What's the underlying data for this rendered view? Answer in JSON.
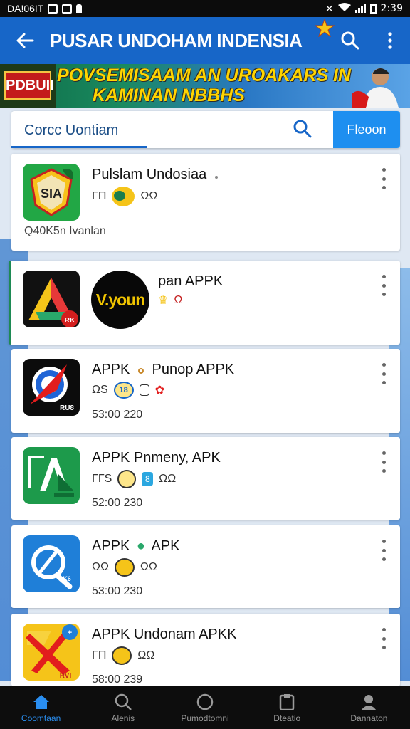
{
  "status_bar": {
    "left_text": "DA!06IT",
    "time": "2:39"
  },
  "app_bar": {
    "title": "PUSAR UNDOHAM INDENSIA",
    "back_icon": "back-arrow-icon",
    "search_icon": "search-icon",
    "menu_icon": "more-vertical-icon"
  },
  "banner": {
    "logo_text": "PDBUII",
    "line1": "POVSEMISAAM AN UROAKARS IN",
    "line2": "KAMINAN NBBHS"
  },
  "search": {
    "query": "Corcc Uontiam",
    "action_label": "Fleoon"
  },
  "apps": [
    {
      "name": "Pulslam Undosiaa",
      "extra": "",
      "date": "",
      "meta": "Q40K5n Ivanlan",
      "icon_text": "SIA"
    },
    {
      "name": "pan APPK",
      "extra": "",
      "date": "",
      "meta": "",
      "icon_text": "RK",
      "overlay_text": "V.youn"
    },
    {
      "name": "APPK",
      "extra": "Punop APPK",
      "date": "53:00 220",
      "meta": "",
      "icon_text": "RU8"
    },
    {
      "name": "APPK Pnmeny, APK",
      "extra": "",
      "date": "52:00 230",
      "meta": "",
      "icon_text": ""
    },
    {
      "name": "APPK",
      "extra": "APK",
      "date": "53:00 230",
      "meta": "",
      "icon_text": "K6"
    },
    {
      "name": "APPK Undonam APKK",
      "extra": "",
      "date": "58:00 239",
      "meta": "",
      "icon_text": "RVI"
    }
  ],
  "badges": {
    "row1": [
      "ΓΠ",
      "ΩΩ"
    ],
    "row2": [
      "Ω"
    ],
    "row3": [
      "ΩS"
    ],
    "row4": [
      "ΓΓS",
      "ΩΩ"
    ],
    "row5": [
      "ΩΩ",
      "ΩΩ"
    ],
    "row6": [
      "ΓΠ",
      "ΩΩ"
    ]
  },
  "bottom_nav": [
    {
      "label": "Coomtaan",
      "icon": "home-icon",
      "active": true
    },
    {
      "label": "Alenis",
      "icon": "search-icon",
      "active": false
    },
    {
      "label": "Pumodtomni",
      "icon": "circle-icon",
      "active": false
    },
    {
      "label": "Dteatio",
      "icon": "clipboard-icon",
      "active": false
    },
    {
      "label": "Dannaton",
      "icon": "person-icon",
      "active": false
    }
  ]
}
